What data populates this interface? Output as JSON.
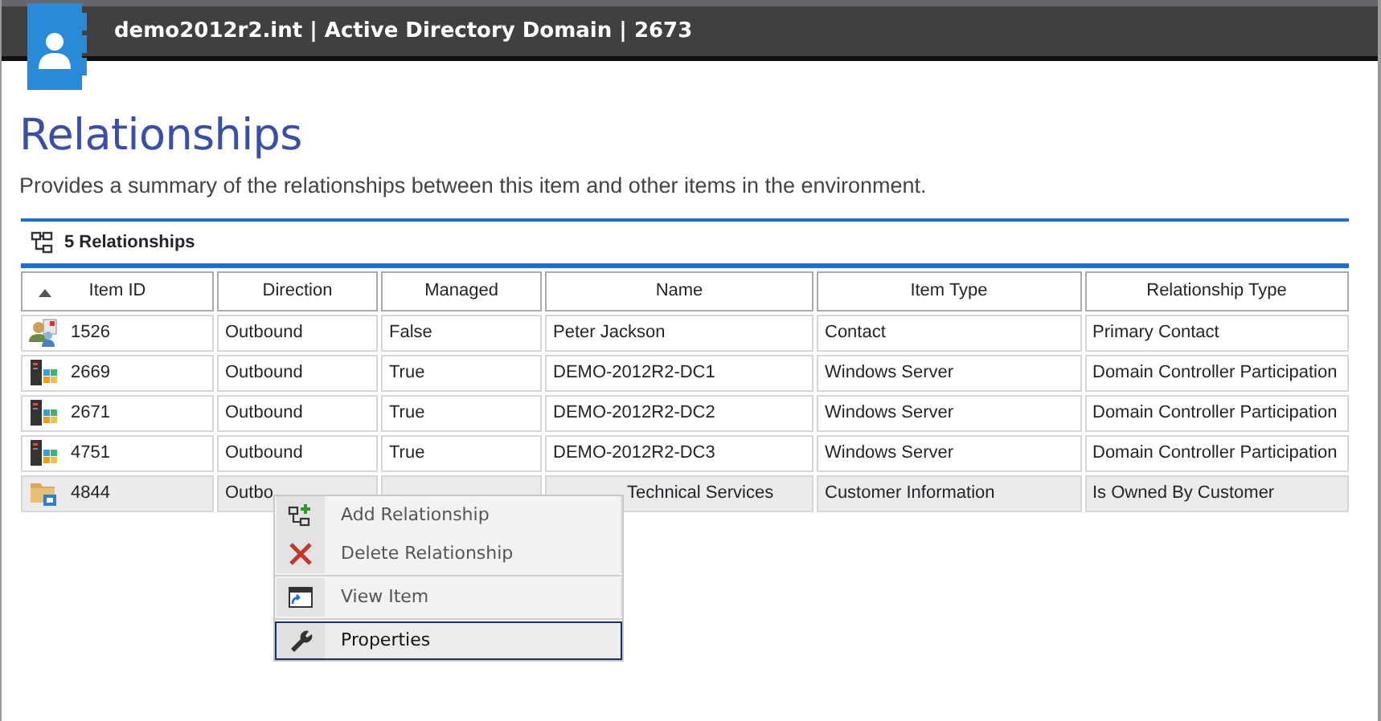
{
  "header": {
    "title": "demo2012r2.int | Active Directory Domain | 2673"
  },
  "page": {
    "title": "Relationships",
    "subtitle": "Provides a summary of the relationships between this item and other items in the environment."
  },
  "section": {
    "title": "5 Relationships"
  },
  "table": {
    "columns": [
      {
        "label": "Item ID",
        "sorted": true
      },
      {
        "label": "Direction",
        "sorted": false
      },
      {
        "label": "Managed",
        "sorted": false
      },
      {
        "label": "Name",
        "sorted": false
      },
      {
        "label": "Item Type",
        "sorted": false
      },
      {
        "label": "Relationship Type",
        "sorted": false
      }
    ],
    "rows": [
      {
        "kind": "contact",
        "selected": false,
        "covered": false,
        "cells": [
          "1526",
          "Outbound",
          "False",
          "Peter Jackson",
          "Contact",
          "Primary Contact"
        ]
      },
      {
        "kind": "server",
        "selected": false,
        "covered": false,
        "cells": [
          "2669",
          "Outbound",
          "True",
          "DEMO-2012R2-DC1",
          "Windows Server",
          "Domain Controller Participation"
        ]
      },
      {
        "kind": "server",
        "selected": false,
        "covered": false,
        "cells": [
          "2671",
          "Outbound",
          "True",
          "DEMO-2012R2-DC2",
          "Windows Server",
          "Domain Controller Participation"
        ]
      },
      {
        "kind": "server",
        "selected": false,
        "covered": false,
        "cells": [
          "4751",
          "Outbound",
          "True",
          "DEMO-2012R2-DC3",
          "Windows Server",
          "Domain Controller Participation"
        ]
      },
      {
        "kind": "customer",
        "selected": true,
        "covered": true,
        "cells": [
          "4844",
          "Outbo",
          "",
          "Technical Services",
          "Customer Information",
          "Is Owned By Customer"
        ]
      }
    ]
  },
  "context_menu": {
    "groups": [
      [
        {
          "kind": "add",
          "label": "Add Relationship",
          "highlighted": false
        },
        {
          "kind": "delete",
          "label": "Delete Relationship",
          "highlighted": false
        }
      ],
      [
        {
          "kind": "view",
          "label": "View Item",
          "highlighted": false
        }
      ],
      [
        {
          "kind": "properties",
          "label": "Properties",
          "highlighted": true
        }
      ]
    ]
  }
}
